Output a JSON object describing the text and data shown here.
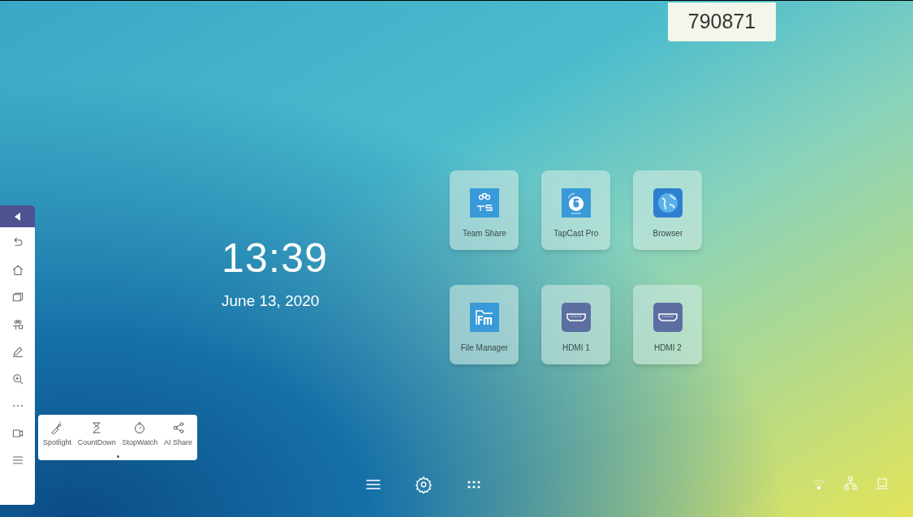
{
  "badge": {
    "code": "790871"
  },
  "clock": {
    "time": "13:39",
    "date": "June 13, 2020"
  },
  "apps": [
    {
      "label": "Team Share",
      "kind": "teamshare"
    },
    {
      "label": "TapCast Pro",
      "kind": "tapcast"
    },
    {
      "label": "Browser",
      "kind": "browser"
    },
    {
      "label": "File Manager",
      "kind": "filemanager"
    },
    {
      "label": "HDMI 1",
      "kind": "hdmi"
    },
    {
      "label": "HDMI 2",
      "kind": "hdmi"
    }
  ],
  "tools": [
    {
      "label": "Spotlight",
      "kind": "spotlight"
    },
    {
      "label": "CountDown",
      "kind": "countdown"
    },
    {
      "label": "StopWatch",
      "kind": "stopwatch"
    },
    {
      "label": "AI Share",
      "kind": "share"
    }
  ]
}
